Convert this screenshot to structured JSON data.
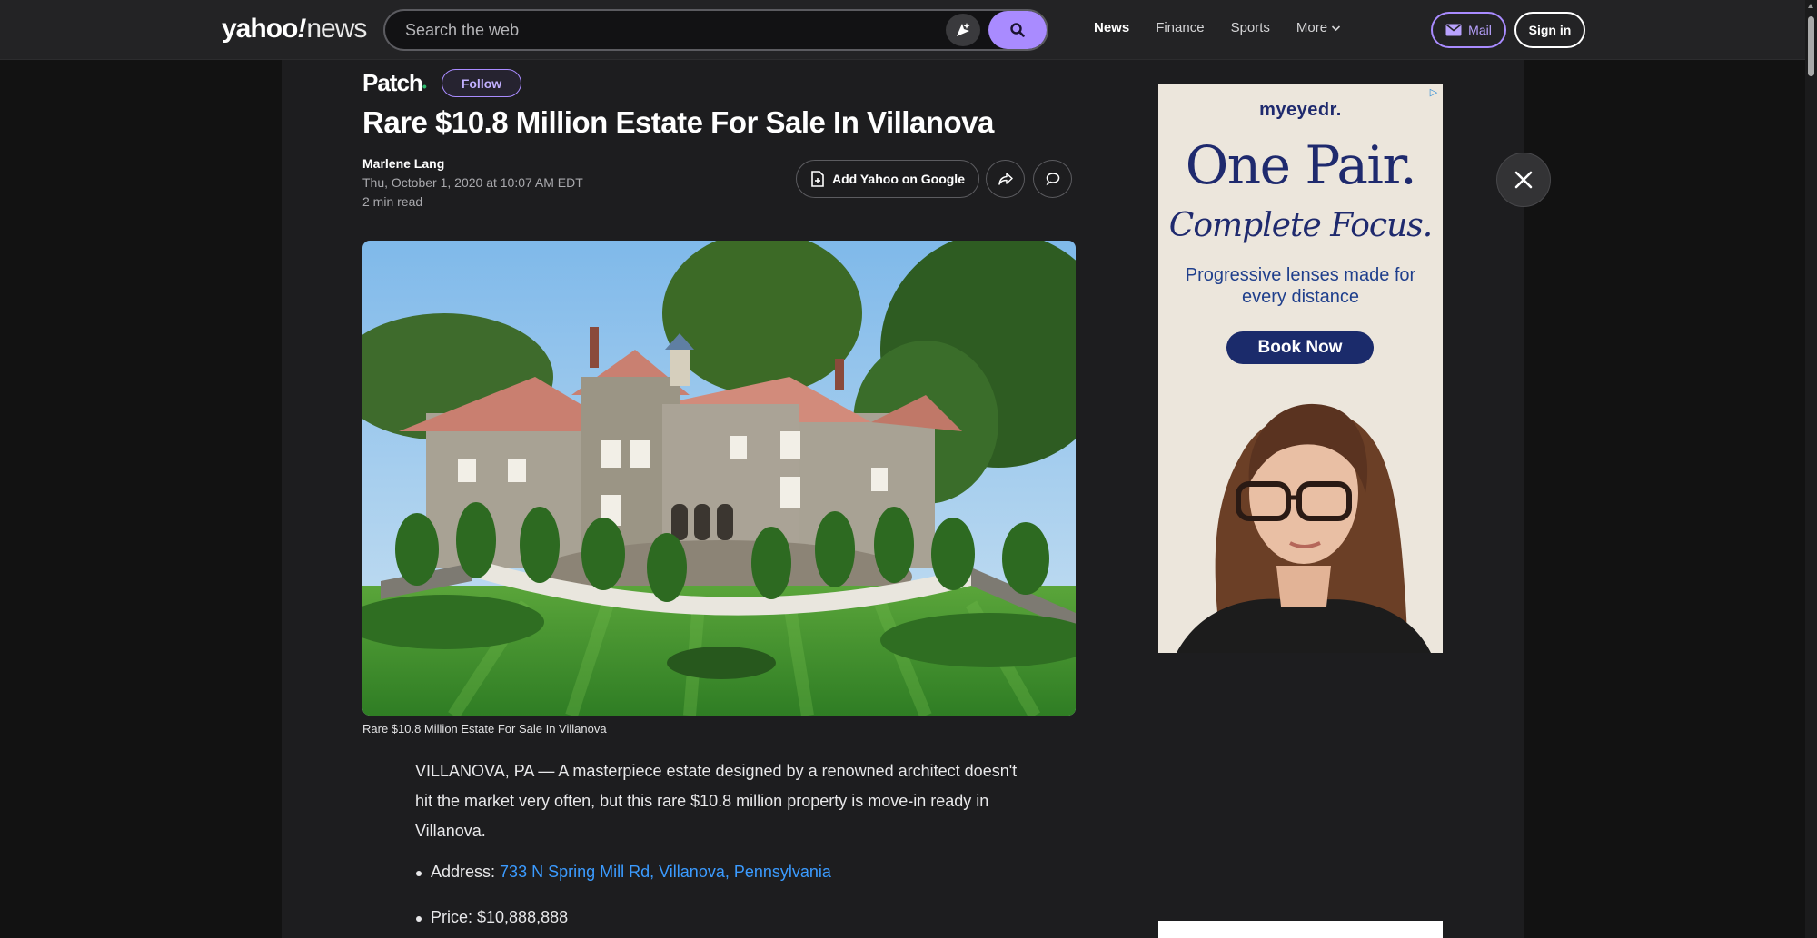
{
  "header": {
    "logo_main": "yahoo",
    "logo_bang": "!",
    "logo_sub": "news",
    "search_placeholder": "Search the web",
    "nav": [
      {
        "label": "News",
        "active": true
      },
      {
        "label": "Finance",
        "active": false
      },
      {
        "label": "Sports",
        "active": false
      },
      {
        "label": "More",
        "active": false
      }
    ],
    "mail_label": "Mail",
    "signin_label": "Sign in",
    "accent_color": "#a98bff"
  },
  "article": {
    "publisher": "Patch",
    "follow_label": "Follow",
    "headline": "Rare $10.8 Million Estate For Sale In Villanova",
    "author": "Marlene Lang",
    "date": "Thu, October 1, 2020 at 10:07 AM EDT",
    "read_time": "2 min read",
    "add_yahoo_label": "Add Yahoo on Google",
    "caption": "Rare $10.8 Million Estate For Sale In Villanova",
    "intro": "VILLANOVA, PA — A masterpiece estate designed by a renowned architect doesn't hit the market very often, but this rare $10.8 million property is move-in ready in Villanova.",
    "bullets": [
      {
        "label": "Address: ",
        "value": "733 N Spring Mill Rd, Villanova, Pennsylvania",
        "link": true
      },
      {
        "label": "Price: ",
        "value": "$10,888,888",
        "link": false
      }
    ]
  },
  "ad": {
    "brand": "myeyedr.",
    "headline": "One Pair.",
    "subheadline": "Complete Focus.",
    "body": "Progressive lenses made for every distance",
    "cta": "Book Now"
  }
}
